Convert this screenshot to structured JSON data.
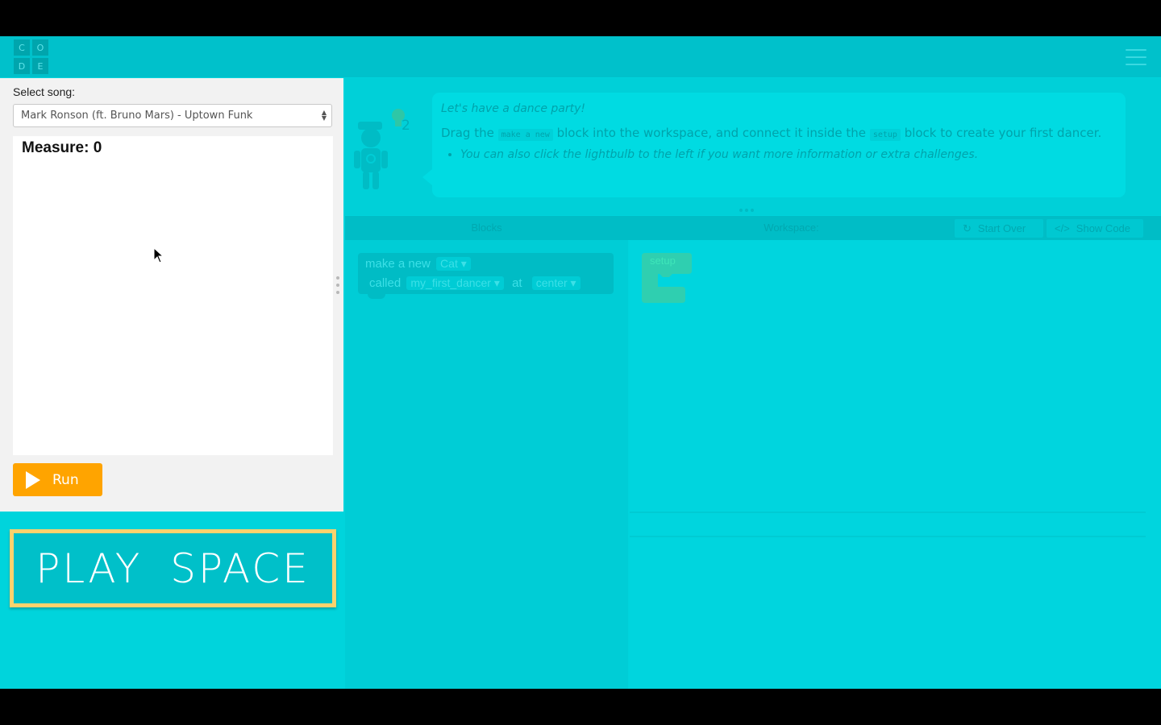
{
  "logo": {
    "letters": [
      "C",
      "O",
      "D",
      "E"
    ]
  },
  "left_panel": {
    "song_label": "Select song:",
    "song_selected": "Mark Ronson (ft. Bruno Mars) - Uptown Funk",
    "measure_text": "Measure: 0",
    "run_label": "Run"
  },
  "play_space": {
    "text": "PLAY SPACE"
  },
  "instructions": {
    "title": "Let's have a dance party!",
    "line_part1": "Drag the ",
    "code1": "make a new",
    "line_part2": " block into the workspace, and connect it inside the ",
    "code2": "setup",
    "line_part3": " block to create your first dancer.",
    "bullet": "You can also click the lightbulb to the left if you want more information or extra challenges.",
    "hint_count": "2"
  },
  "workspace_header": {
    "blocks_label": "Blocks",
    "workspace_label": "Workspace:",
    "start_over_label": "Start Over",
    "show_code_label": "Show Code"
  },
  "toolbox": {
    "make_new": "make a new",
    "sprite_dropdown": "Cat ▾",
    "called": "called",
    "name_dropdown": "my_first_dancer ▾",
    "at": "at",
    "location_dropdown": "center ▾"
  },
  "workspace": {
    "setup_label": "setup"
  },
  "colors": {
    "app_bg": "#00d4dc",
    "header_bg": "#00c1cb",
    "run_button": "#ffa400",
    "play_space_border": "#fcd26d"
  }
}
